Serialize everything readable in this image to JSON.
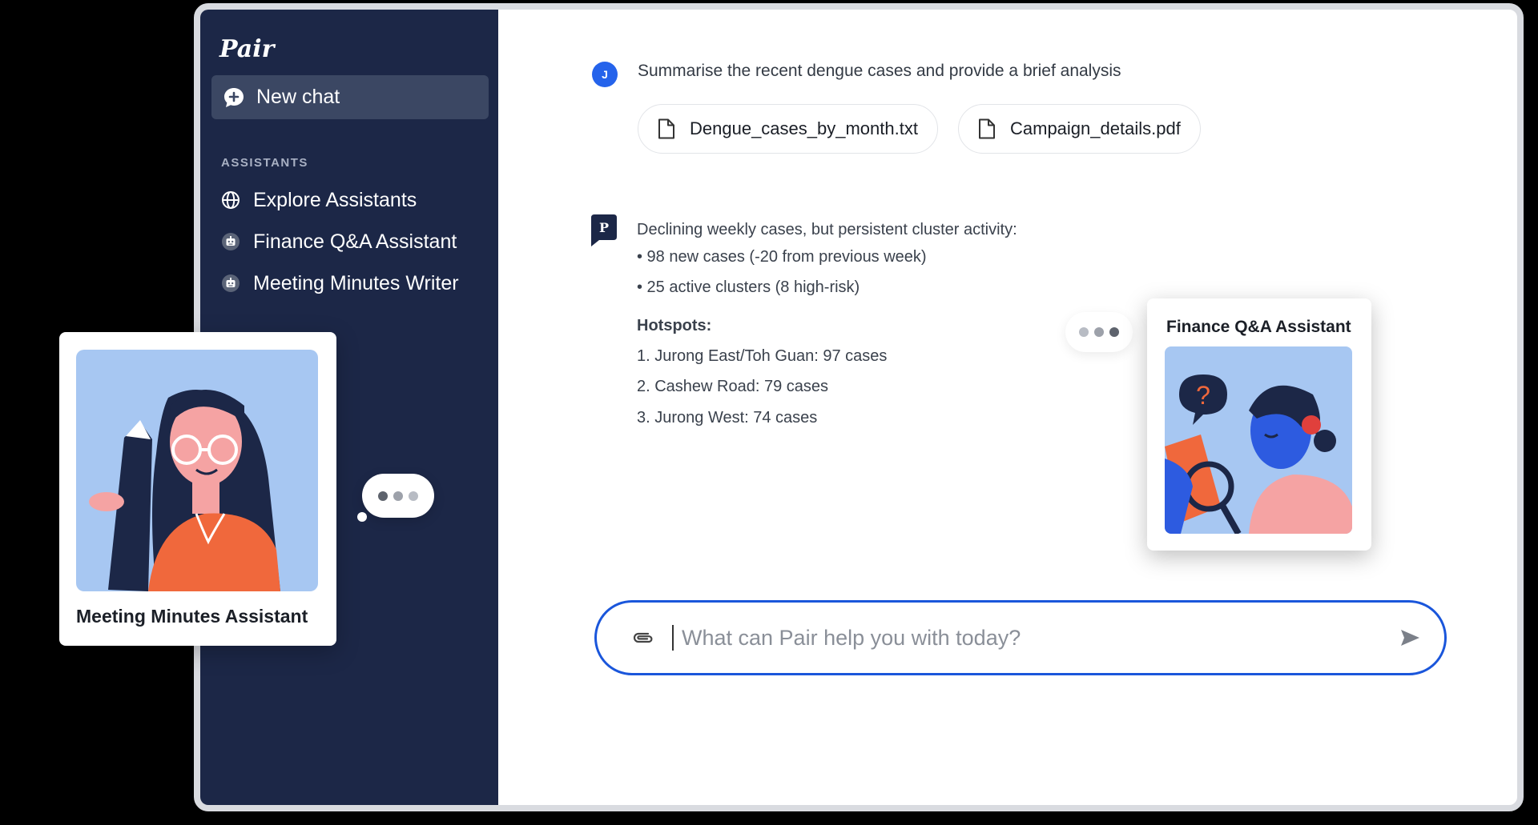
{
  "sidebar": {
    "logo": "Pair",
    "new_chat_label": "New chat",
    "section_label": "ASSISTANTS",
    "items": [
      {
        "label": "Explore Assistants",
        "icon": "globe-icon"
      },
      {
        "label": "Finance Q&A Assistant",
        "icon": "robot-icon"
      },
      {
        "label": "Meeting Minutes Writer",
        "icon": "robot-icon"
      }
    ]
  },
  "conversation": {
    "user_avatar": "J",
    "user_message": "Summarise the recent dengue cases and provide a brief analysis",
    "attachments": [
      {
        "name": "Dengue_cases_by_month.txt",
        "icon": "file-icon"
      },
      {
        "name": "Campaign_details.pdf",
        "icon": "file-icon"
      }
    ],
    "assistant_avatar": "P",
    "reply": {
      "intro": "Declining weekly cases, but persistent cluster activity:",
      "bullets": [
        "• 98 new cases (-20 from previous week)",
        "• 25 active clusters (8 high-risk)"
      ],
      "hotspots_heading": "Hotspots:",
      "hotspots": [
        "1. Jurong East/Toh Guan: 97 cases",
        "2. Cashew Road: 79 cases",
        "3. Jurong West: 74 cases"
      ]
    }
  },
  "composer": {
    "placeholder": "What can Pair help you with today?",
    "attach_icon": "paperclip-icon",
    "send_icon": "send-icon"
  },
  "cards": {
    "meeting": {
      "title": "Meeting Minutes Assistant"
    },
    "finance": {
      "title": "Finance Q&A Assistant"
    }
  },
  "colors": {
    "sidebar_bg": "#1c2747",
    "new_chat_bg": "#3b4763",
    "accent_blue": "#1a56db",
    "user_avatar": "#2563eb"
  }
}
